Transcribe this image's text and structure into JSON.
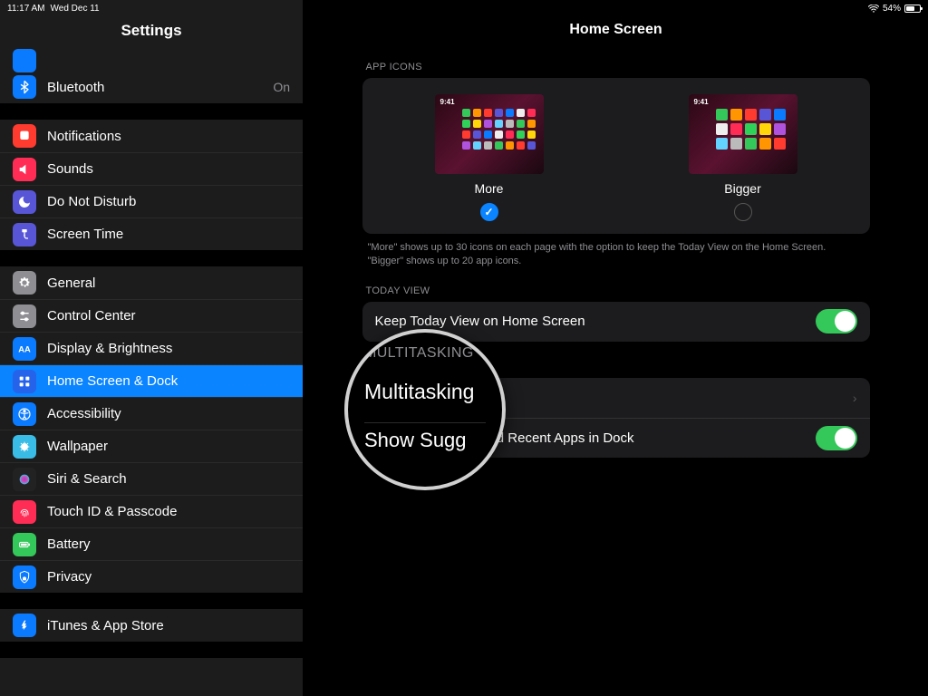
{
  "status": {
    "time": "11:17 AM",
    "date": "Wed Dec 11",
    "battery": "54%"
  },
  "sidebar": {
    "title": "Settings",
    "groups": [
      [
        {
          "label": "Bluetooth",
          "icon": "bluetooth",
          "color": "#0a7aff",
          "value": "On"
        }
      ],
      [
        {
          "label": "Notifications",
          "icon": "notifications",
          "color": "#ff3b30"
        },
        {
          "label": "Sounds",
          "icon": "sounds",
          "color": "#ff2d55"
        },
        {
          "label": "Do Not Disturb",
          "icon": "dnd",
          "color": "#5856d6"
        },
        {
          "label": "Screen Time",
          "icon": "screentime",
          "color": "#5856d6"
        }
      ],
      [
        {
          "label": "General",
          "icon": "general",
          "color": "#8e8e93"
        },
        {
          "label": "Control Center",
          "icon": "controlcenter",
          "color": "#8e8e93"
        },
        {
          "label": "Display & Brightness",
          "icon": "display",
          "color": "#0a7aff"
        },
        {
          "label": "Home Screen & Dock",
          "icon": "homescreen",
          "color": "#2563eb",
          "selected": true
        },
        {
          "label": "Accessibility",
          "icon": "accessibility",
          "color": "#0a7aff"
        },
        {
          "label": "Wallpaper",
          "icon": "wallpaper",
          "color": "#39bce6"
        },
        {
          "label": "Siri & Search",
          "icon": "siri",
          "color": "#222"
        },
        {
          "label": "Touch ID & Passcode",
          "icon": "touchid",
          "color": "#ff2d55"
        },
        {
          "label": "Battery",
          "icon": "battery",
          "color": "#34c759"
        },
        {
          "label": "Privacy",
          "icon": "privacy",
          "color": "#0a7aff"
        }
      ],
      [
        {
          "label": "iTunes & App Store",
          "icon": "appstore",
          "color": "#0a7aff"
        }
      ]
    ]
  },
  "detail": {
    "title": "Home Screen",
    "app_icons": {
      "header": "APP ICONS",
      "more": "More",
      "bigger": "Bigger",
      "time": "9:41",
      "caption": "\"More\" shows up to 30 icons on each page with the option to keep the Today View on the Home Screen. \"Bigger\" shows up to 20 app icons."
    },
    "today": {
      "header": "TODAY VIEW",
      "row": "Keep Today View on Home Screen"
    },
    "multi": {
      "header": "MULTITASKING",
      "row1": "Multitasking",
      "row2": "Show Suggested and Recent Apps in Dock"
    }
  },
  "magnifier": {
    "header": "MULTITASKING",
    "main": "Multitasking",
    "sub": "Show Sugg"
  }
}
